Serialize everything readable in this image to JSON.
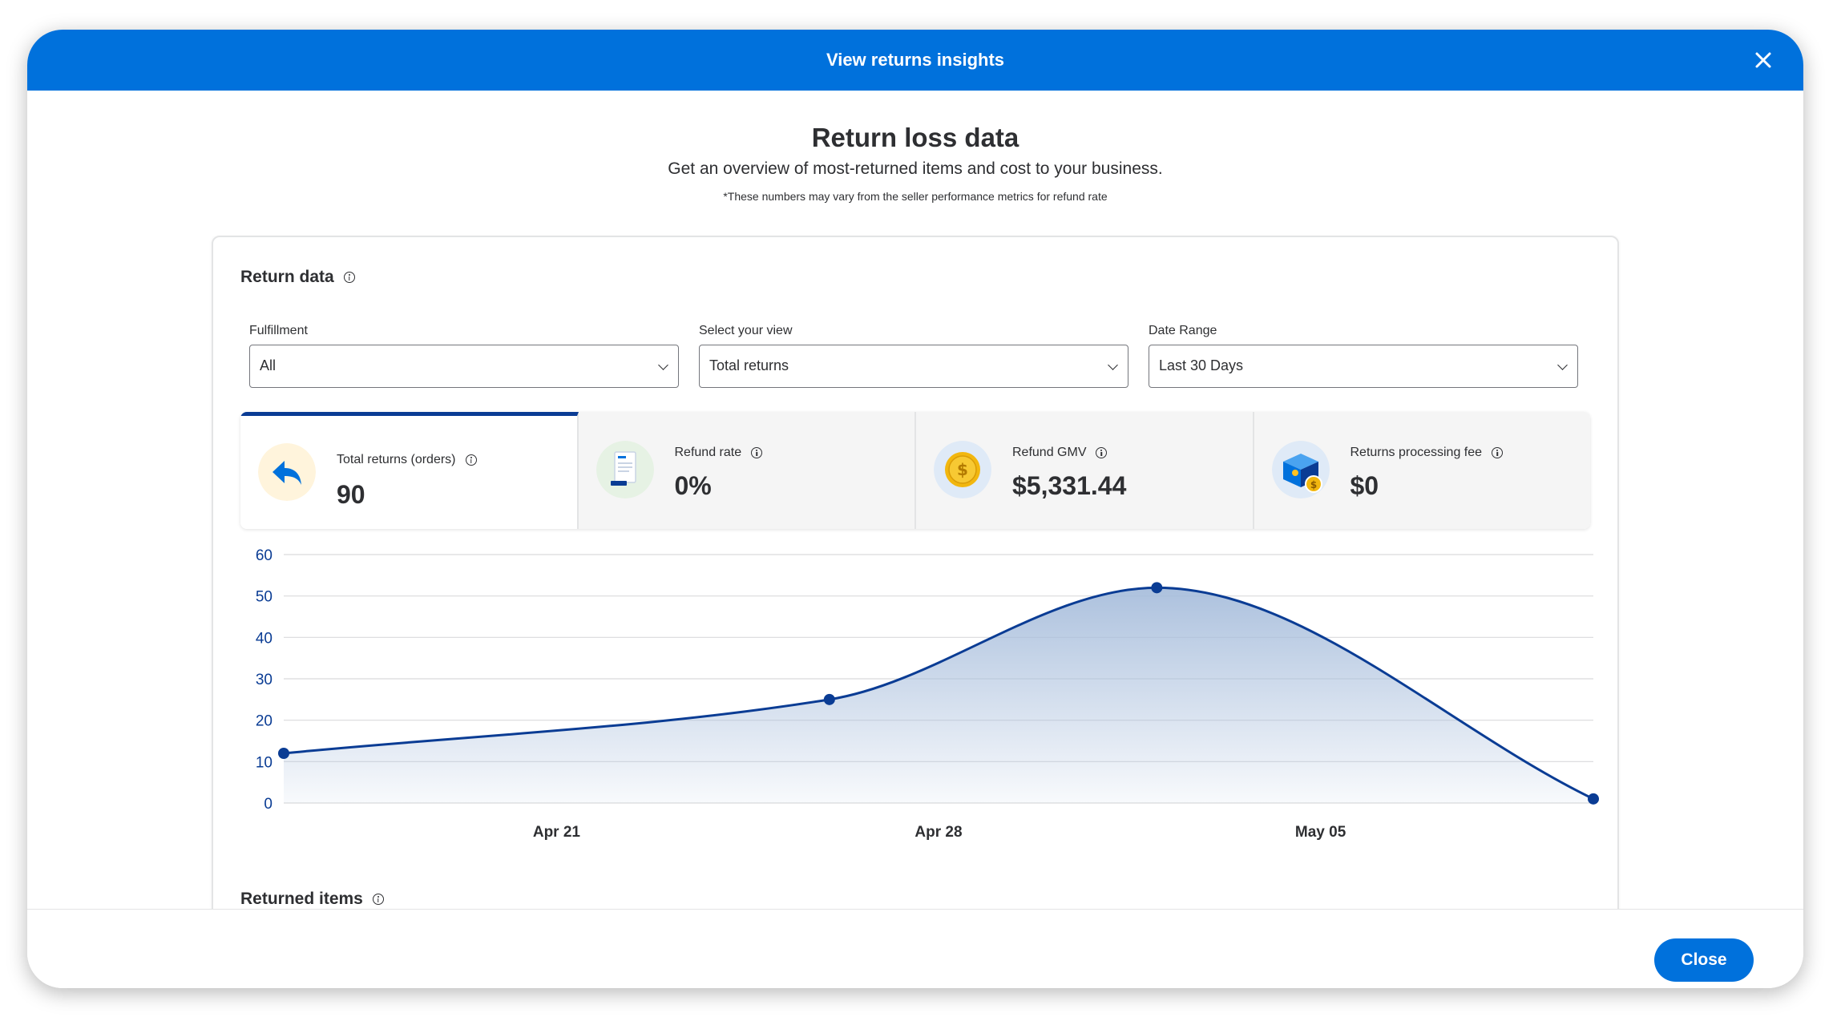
{
  "modal": {
    "title": "View returns insights",
    "heading": "Return loss data",
    "subtitle": "Get an overview of most-returned items and cost to your business.",
    "note": "*These numbers may vary from the seller performance metrics for refund rate"
  },
  "card": {
    "heading": "Return data",
    "returned_items_heading": "Returned items"
  },
  "filters": [
    {
      "label": "Fulfillment",
      "value": "All"
    },
    {
      "label": "Select your view",
      "value": "Total returns"
    },
    {
      "label": "Date Range",
      "value": "Last 30 Days"
    }
  ],
  "metrics": [
    {
      "label": "Total returns (orders)",
      "value": "90",
      "icon": "return-arrow-icon",
      "active": true
    },
    {
      "label": "Refund rate",
      "value": "0%",
      "icon": "receipt-icon",
      "active": false
    },
    {
      "label": "Refund GMV",
      "value": "$5,331.44",
      "icon": "dollar-coin-icon",
      "active": false
    },
    {
      "label": "Returns processing fee",
      "value": "$0",
      "icon": "package-coin-icon",
      "active": false
    }
  ],
  "colors": {
    "header": "#0071dc",
    "accent": "#0a3c94",
    "area_fill": "#a8bedc"
  },
  "chart_data": {
    "type": "area",
    "x": [
      "Apr 16",
      "Apr 26",
      "May 02",
      "May 10"
    ],
    "values": [
      12,
      25,
      52,
      1
    ],
    "xticks": [
      "Apr 21",
      "Apr 28",
      "May 05"
    ],
    "ylim": [
      0,
      60
    ],
    "yticks": [
      0,
      10,
      20,
      30,
      40,
      50,
      60
    ],
    "grid": true
  },
  "footer": {
    "close_label": "Close"
  }
}
